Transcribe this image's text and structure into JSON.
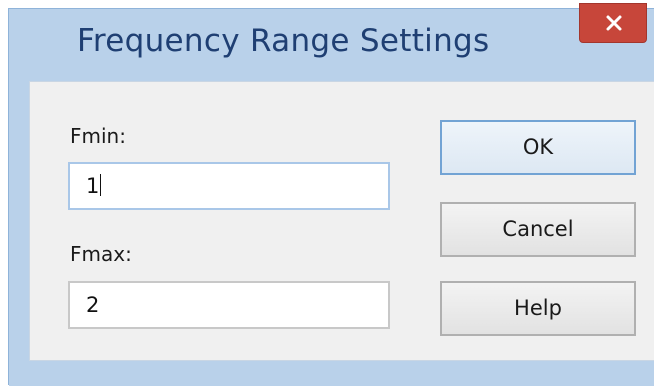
{
  "dialog": {
    "title": "Frequency Range Settings",
    "close_icon": "close-icon",
    "fmin": {
      "label": "Fmin:",
      "value": "1"
    },
    "fmax": {
      "label": "Fmax:",
      "value": "2"
    },
    "buttons": {
      "ok": "OK",
      "cancel": "Cancel",
      "help": "Help"
    }
  },
  "colors": {
    "frame": "#b9d1ea",
    "title_text": "#1f3f73",
    "close_button": "#c7463a",
    "client_background": "#f0f0f0",
    "focus_border": "#a9c7e8"
  }
}
